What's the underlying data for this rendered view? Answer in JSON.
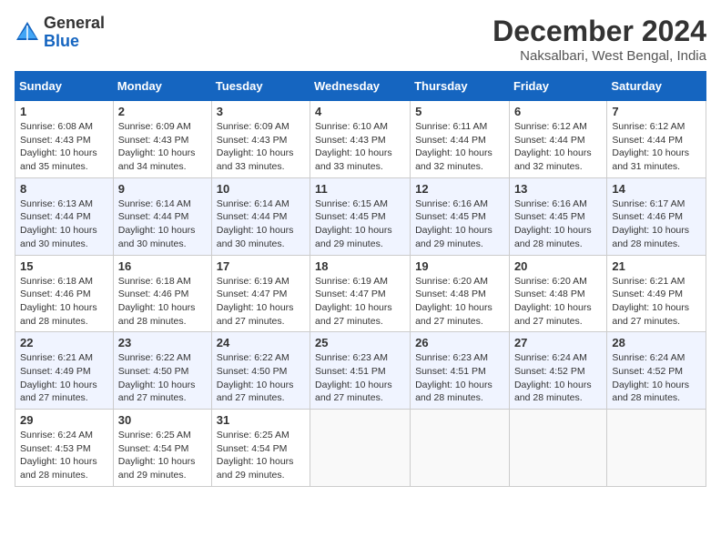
{
  "header": {
    "logo_general": "General",
    "logo_blue": "Blue",
    "month_title": "December 2024",
    "location": "Naksalbari, West Bengal, India"
  },
  "weekdays": [
    "Sunday",
    "Monday",
    "Tuesday",
    "Wednesday",
    "Thursday",
    "Friday",
    "Saturday"
  ],
  "weeks": [
    [
      {
        "day": 1,
        "sunrise": "6:08 AM",
        "sunset": "4:43 PM",
        "daylight": "10 hours and 35 minutes."
      },
      {
        "day": 2,
        "sunrise": "6:09 AM",
        "sunset": "4:43 PM",
        "daylight": "10 hours and 34 minutes."
      },
      {
        "day": 3,
        "sunrise": "6:09 AM",
        "sunset": "4:43 PM",
        "daylight": "10 hours and 33 minutes."
      },
      {
        "day": 4,
        "sunrise": "6:10 AM",
        "sunset": "4:43 PM",
        "daylight": "10 hours and 33 minutes."
      },
      {
        "day": 5,
        "sunrise": "6:11 AM",
        "sunset": "4:44 PM",
        "daylight": "10 hours and 32 minutes."
      },
      {
        "day": 6,
        "sunrise": "6:12 AM",
        "sunset": "4:44 PM",
        "daylight": "10 hours and 32 minutes."
      },
      {
        "day": 7,
        "sunrise": "6:12 AM",
        "sunset": "4:44 PM",
        "daylight": "10 hours and 31 minutes."
      }
    ],
    [
      {
        "day": 8,
        "sunrise": "6:13 AM",
        "sunset": "4:44 PM",
        "daylight": "10 hours and 30 minutes."
      },
      {
        "day": 9,
        "sunrise": "6:14 AM",
        "sunset": "4:44 PM",
        "daylight": "10 hours and 30 minutes."
      },
      {
        "day": 10,
        "sunrise": "6:14 AM",
        "sunset": "4:44 PM",
        "daylight": "10 hours and 30 minutes."
      },
      {
        "day": 11,
        "sunrise": "6:15 AM",
        "sunset": "4:45 PM",
        "daylight": "10 hours and 29 minutes."
      },
      {
        "day": 12,
        "sunrise": "6:16 AM",
        "sunset": "4:45 PM",
        "daylight": "10 hours and 29 minutes."
      },
      {
        "day": 13,
        "sunrise": "6:16 AM",
        "sunset": "4:45 PM",
        "daylight": "10 hours and 28 minutes."
      },
      {
        "day": 14,
        "sunrise": "6:17 AM",
        "sunset": "4:46 PM",
        "daylight": "10 hours and 28 minutes."
      }
    ],
    [
      {
        "day": 15,
        "sunrise": "6:18 AM",
        "sunset": "4:46 PM",
        "daylight": "10 hours and 28 minutes."
      },
      {
        "day": 16,
        "sunrise": "6:18 AM",
        "sunset": "4:46 PM",
        "daylight": "10 hours and 28 minutes."
      },
      {
        "day": 17,
        "sunrise": "6:19 AM",
        "sunset": "4:47 PM",
        "daylight": "10 hours and 27 minutes."
      },
      {
        "day": 18,
        "sunrise": "6:19 AM",
        "sunset": "4:47 PM",
        "daylight": "10 hours and 27 minutes."
      },
      {
        "day": 19,
        "sunrise": "6:20 AM",
        "sunset": "4:48 PM",
        "daylight": "10 hours and 27 minutes."
      },
      {
        "day": 20,
        "sunrise": "6:20 AM",
        "sunset": "4:48 PM",
        "daylight": "10 hours and 27 minutes."
      },
      {
        "day": 21,
        "sunrise": "6:21 AM",
        "sunset": "4:49 PM",
        "daylight": "10 hours and 27 minutes."
      }
    ],
    [
      {
        "day": 22,
        "sunrise": "6:21 AM",
        "sunset": "4:49 PM",
        "daylight": "10 hours and 27 minutes."
      },
      {
        "day": 23,
        "sunrise": "6:22 AM",
        "sunset": "4:50 PM",
        "daylight": "10 hours and 27 minutes."
      },
      {
        "day": 24,
        "sunrise": "6:22 AM",
        "sunset": "4:50 PM",
        "daylight": "10 hours and 27 minutes."
      },
      {
        "day": 25,
        "sunrise": "6:23 AM",
        "sunset": "4:51 PM",
        "daylight": "10 hours and 27 minutes."
      },
      {
        "day": 26,
        "sunrise": "6:23 AM",
        "sunset": "4:51 PM",
        "daylight": "10 hours and 28 minutes."
      },
      {
        "day": 27,
        "sunrise": "6:24 AM",
        "sunset": "4:52 PM",
        "daylight": "10 hours and 28 minutes."
      },
      {
        "day": 28,
        "sunrise": "6:24 AM",
        "sunset": "4:52 PM",
        "daylight": "10 hours and 28 minutes."
      }
    ],
    [
      {
        "day": 29,
        "sunrise": "6:24 AM",
        "sunset": "4:53 PM",
        "daylight": "10 hours and 28 minutes."
      },
      {
        "day": 30,
        "sunrise": "6:25 AM",
        "sunset": "4:54 PM",
        "daylight": "10 hours and 29 minutes."
      },
      {
        "day": 31,
        "sunrise": "6:25 AM",
        "sunset": "4:54 PM",
        "daylight": "10 hours and 29 minutes."
      },
      null,
      null,
      null,
      null
    ]
  ]
}
